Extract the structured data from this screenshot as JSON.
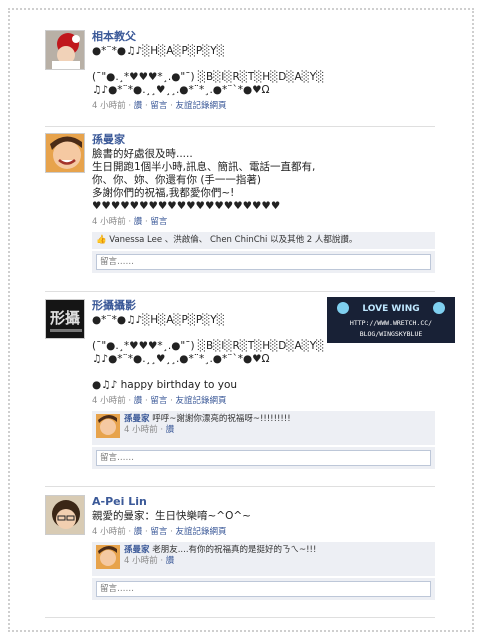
{
  "posts": [
    {
      "author": "相本教父",
      "avatar_icon": "avatar-child-red-hat",
      "text": "●*¨*●♫♪░H░A░P░P░Y░\n\n(¯\"●.¸*♥♥♥*¸.●\"¯) ░B░I░R░T░H░D░A░Y░\n♫♪●*¨*●.¸¸♥¸¸.●*¨*¸.●*¨`*●♥Ω",
      "time": "4 小時前",
      "like": "讚",
      "comment": "留言",
      "wall": "友誼記錄網頁"
    },
    {
      "author": "孫曼家",
      "avatar_icon": "avatar-smiling-woman",
      "text": "臉書的好處很及時.....\n生日開跑1個半小時,訊息、簡訊、電話一直都有,\n你、你、妳、你還有你 (手一一指著)\n多謝你們的祝福,我都愛你們~!\n♥♥♥♥♥♥♥♥♥♥♥♥♥♥♥♥♥♥♥♥",
      "time": "4 小時前",
      "like": "讚",
      "comment": "留言",
      "likes_text": "Vanessa Lee 、洪啟倫、 Chen ChinChi 以及其他 2 人都說讚。",
      "comment_placeholder": "留言……"
    },
    {
      "author": "形攝攝影",
      "avatar_icon": "avatar-logo-text",
      "avatar_text": "形攝",
      "text": "●*¨*●♫♪░H░A░P░P░Y░\n\n(¯\"●.¸*♥♥♥*¸.●\"¯) ░B░I░R░T░H░D░A░Y░\n♫♪●*¨*●.¸¸♥¸¸.●*¨*¸.●*¨`*●♥Ω\n\n●♫♪ happy birthday to you",
      "time": "4 小時前",
      "like": "讚",
      "comment": "留言",
      "wall": "友誼記錄網頁",
      "reply": {
        "author": "孫曼家",
        "text": "呼呼~謝謝你漂亮的祝福呀~!!!!!!!!!",
        "time": "4 小時前",
        "like": "讚"
      },
      "comment_placeholder": "留言……"
    },
    {
      "author": "A-Pei Lin",
      "avatar_icon": "avatar-woman-glasses",
      "text": "親愛的曼家：生日快樂唷~^O^~",
      "time": "4 小時前",
      "like": "讚",
      "comment": "留言",
      "wall": "友誼記錄網頁",
      "reply": {
        "author": "孫曼家",
        "text": "老朋友....有你的祝福真的是挺好的ㄋㄟ~!!!",
        "time": "4 小時前",
        "like": "讚"
      },
      "comment_placeholder": "留言……"
    }
  ],
  "ad": {
    "line1": "LOVE WING",
    "line2": "HTTP://WWW.WRETCH.CC/",
    "line3": "BLOG/WINGSKYBLUE"
  },
  "separator": " · "
}
